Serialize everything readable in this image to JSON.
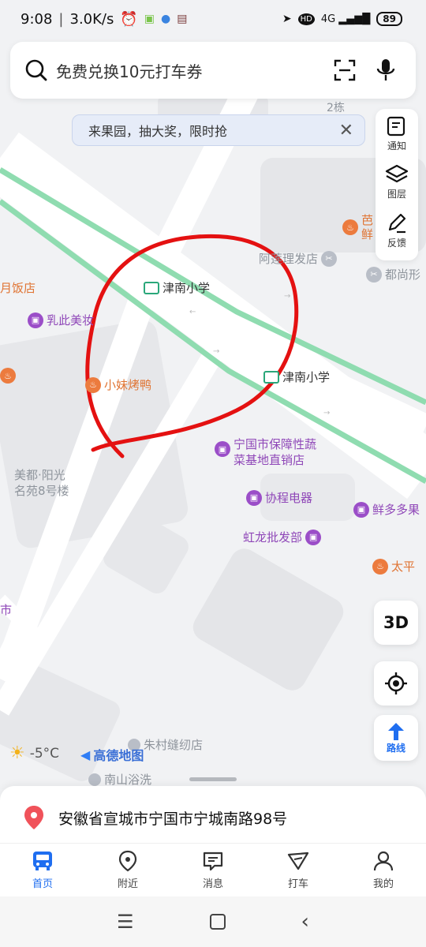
{
  "status_bar": {
    "time": "9:08",
    "speed": "3.0K/s",
    "battery": "89",
    "net": "4G"
  },
  "search": {
    "placeholder": "免费兑换10元打车券"
  },
  "banner": {
    "text": "来果园，抽大奖，限时抢"
  },
  "tools": {
    "notify": "通知",
    "layers": "图层",
    "feedback": "反馈"
  },
  "map_labels": {
    "bldg_2": "2栋",
    "school_1": "津南小学",
    "school_2": "津南小学",
    "restaurant": "小妹烤鸭",
    "beauty": "乳此美妆",
    "fandian": "月饭店",
    "barber": "阿莲理发店",
    "dushang": "都尚形",
    "ba": "芭",
    "xian": "鲜",
    "veg_line1": "宁国市保障性蔬",
    "veg_line2": "菜基地直销店",
    "residence_line1": "美都·阳光",
    "residence_line2": "名苑8号楼",
    "electric": "协程电器",
    "fruit": "鲜多多果",
    "wholesale": "虹龙批发部",
    "taiping": "太平",
    "shi": "市",
    "sewing": "朱村缝纫店",
    "bath": "南山浴洗"
  },
  "controls": {
    "three_d": "3D",
    "route": "路线"
  },
  "weather": {
    "temp": "-5°C"
  },
  "logo": "高德地图",
  "address": "安徽省宣城市宁国市宁城南路98号",
  "tabs": [
    {
      "label": "首页"
    },
    {
      "label": "附近"
    },
    {
      "label": "消息"
    },
    {
      "label": "打车"
    },
    {
      "label": "我的"
    }
  ],
  "colors": {
    "accent": "#1f6ef0",
    "rail": "#8fdcb0",
    "annotation": "#e41111"
  }
}
